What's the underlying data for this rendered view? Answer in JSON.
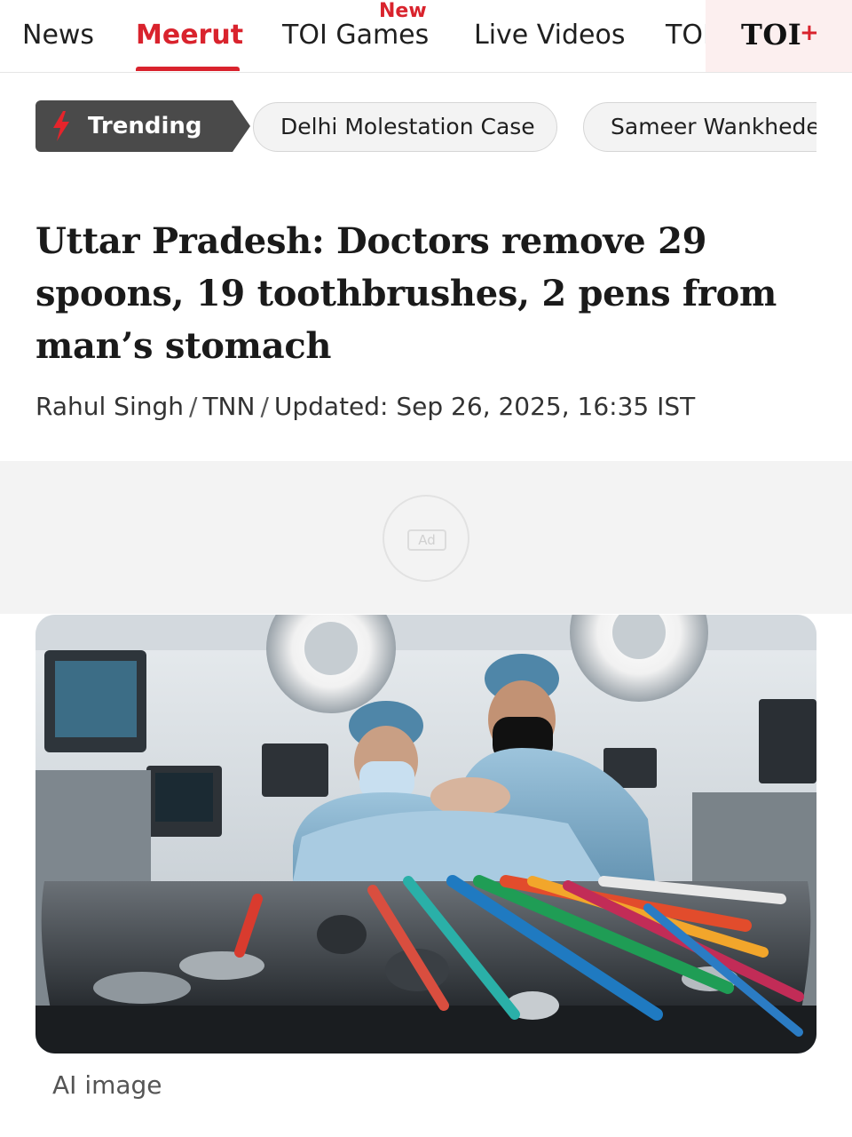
{
  "nav": {
    "items": [
      "News",
      "Meerut",
      "TOI Games",
      "Live Videos",
      "TOI"
    ],
    "active": "Meerut",
    "new_badge": "New",
    "brand": {
      "logo_text": "TOI",
      "plus_symbol": "+"
    },
    "accent_color": "#d9232d"
  },
  "trending": {
    "label": "Trending",
    "icon": "lightning-bolt-icon",
    "topics": [
      "Delhi Molestation Case",
      "Sameer Wankhede"
    ]
  },
  "article": {
    "headline": "Uttar Pradesh: Doctors remove 29 spoons, 19 toothbrushes, 2 pens from man’s stomach",
    "byline": {
      "author": "Rahul Singh",
      "agency": "TNN",
      "updated": "Updated: Sep 26, 2025, 16:35 IST"
    }
  },
  "ad": {
    "label": "Ad"
  },
  "hero_image": {
    "description_icon": "surgery-illustration",
    "caption": "AI image"
  }
}
